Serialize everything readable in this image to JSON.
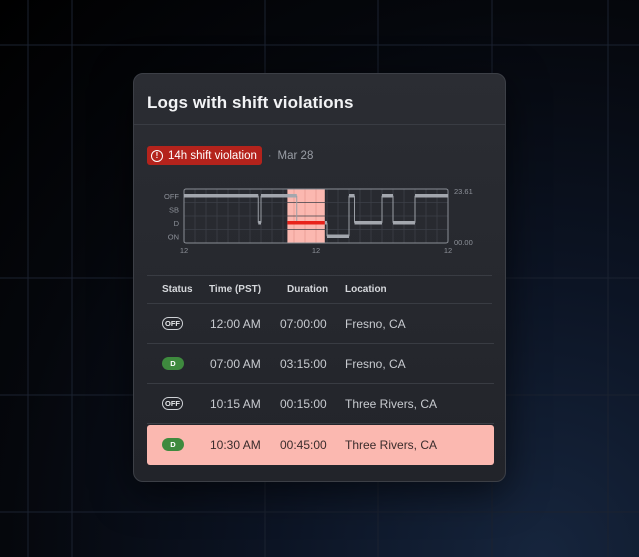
{
  "card": {
    "title": "Logs with shift violations",
    "violation": {
      "label": "14h shift violation",
      "icon": "alert-circle-icon",
      "color": "#b4231c"
    },
    "separator": "·",
    "date": "Mar 28"
  },
  "chart_data": {
    "type": "line",
    "y_categories": [
      "OFF",
      "SB",
      "D",
      "ON"
    ],
    "x_tick_labels": [
      "12",
      "12",
      "12"
    ],
    "x_range": [
      0,
      24
    ],
    "right_labels": [
      "23.61",
      "00.00"
    ],
    "segments": [
      {
        "start": 0,
        "end": 6.75,
        "status": "OFF"
      },
      {
        "start": 6.75,
        "end": 7,
        "status": "D"
      },
      {
        "start": 7,
        "end": 10.25,
        "status": "OFF"
      },
      {
        "start": 10.25,
        "end": 13,
        "status": "D"
      },
      {
        "start": 13,
        "end": 15,
        "status": "ON"
      },
      {
        "start": 15,
        "end": 15.5,
        "status": "OFF"
      },
      {
        "start": 15.5,
        "end": 18,
        "status": "D"
      },
      {
        "start": 18,
        "end": 19,
        "status": "OFF"
      },
      {
        "start": 19,
        "end": 21,
        "status": "D"
      },
      {
        "start": 21,
        "end": 24,
        "status": "OFF"
      }
    ],
    "violation_window": {
      "start": 9.4,
      "end": 12.8
    },
    "violation_segment": {
      "start": 9.4,
      "end": 12.8,
      "status": "D"
    },
    "grid": true
  },
  "table": {
    "headers": [
      "Status",
      "Time (PST)",
      "Duration",
      "Location"
    ],
    "rows": [
      {
        "status": "OFF",
        "time": "12:00 AM",
        "duration": "07:00:00",
        "location": "Fresno, CA",
        "highlight": false
      },
      {
        "status": "D",
        "time": "07:00 AM",
        "duration": "03:15:00",
        "location": "Fresno, CA",
        "highlight": false
      },
      {
        "status": "OFF",
        "time": "10:15 AM",
        "duration": "00:15:00",
        "location": "Three Rivers, CA",
        "highlight": false
      },
      {
        "status": "D",
        "time": "10:30 AM",
        "duration": "00:45:00",
        "location": "Three Rivers, CA",
        "highlight": true
      }
    ]
  },
  "colors": {
    "violation_highlight": "#fbb8b0",
    "driving_pill": "#3e8a3e",
    "violation_line": "#e8221a"
  }
}
